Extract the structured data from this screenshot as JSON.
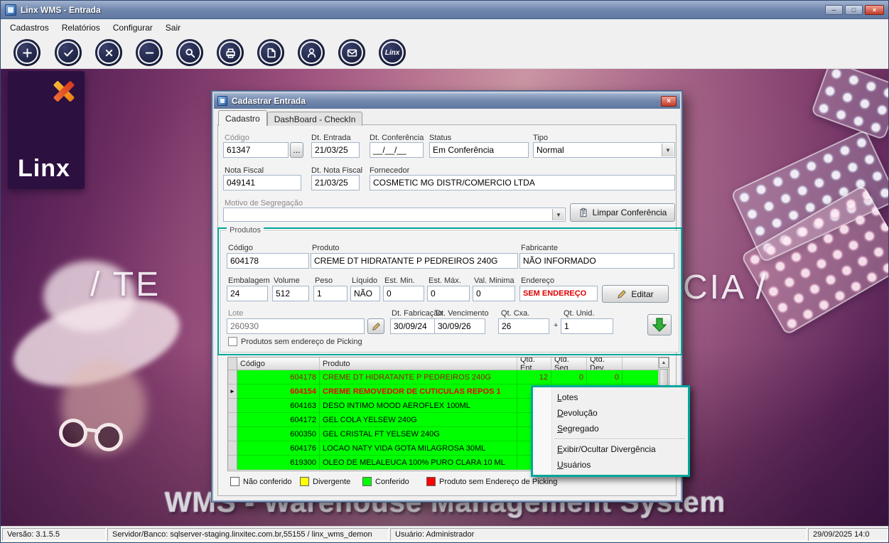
{
  "window": {
    "title": "Linx WMS - Entrada"
  },
  "icons": {
    "minimize": "─",
    "maximize": "□",
    "close": "×",
    "dropdown_arrow": "▼",
    "row_pointer": "►",
    "scroll_up": "▲",
    "scroll_down": "▼"
  },
  "menu": {
    "items": [
      "Cadastros",
      "Relatórios",
      "Configurar",
      "Sair"
    ]
  },
  "toolbar": {
    "linx_label": "Linx",
    "buttons": [
      "add",
      "confirm",
      "cancel",
      "remove",
      "search",
      "print",
      "document",
      "user",
      "send",
      "linx"
    ]
  },
  "background": {
    "logo_text": "Linx",
    "tagline_left": "/ TE",
    "tagline_right": "CIA /",
    "banner": "WMS - Warehouse Management System"
  },
  "dialog": {
    "title": "Cadastrar Entrada",
    "tabs": [
      "Cadastro",
      "DashBoard - CheckIn"
    ],
    "fields": {
      "codigo_label": "Código",
      "codigo": "61347",
      "browse": "...",
      "dt_entrada_label": "Dt. Entrada",
      "dt_entrada": "21/03/25",
      "dt_conferencia_label": "Dt. Conferência",
      "dt_conferencia": "__/__/__",
      "status_label": "Status",
      "status": "Em Conferência",
      "tipo_label": "Tipo",
      "tipo": "Normal",
      "nota_fiscal_label": "Nota Fiscal",
      "nota_fiscal": "049141",
      "dt_nota_fiscal_label": "Dt. Nota Fiscal",
      "dt_nota_fiscal": "21/03/25",
      "fornecedor_label": "Fornecedor",
      "fornecedor": "COSMETIC MG DISTR/COMERCIO LTDA",
      "motivo_label": "Motivo de Segregação",
      "motivo": "",
      "limpar_button": "Limpar Conferência"
    },
    "produtos": {
      "title": "Produtos",
      "codigo_label": "Código",
      "codigo": "604178",
      "produto_label": "Produto",
      "produto": "CREME DT HIDRATANTE P PEDREIROS 240G",
      "fabricante_label": "Fabricante",
      "fabricante": "NÃO INFORMADO",
      "embalagem_label": "Embalagem",
      "embalagem": "24",
      "volume_label": "Volume",
      "volume": "512",
      "peso_label": "Peso",
      "peso": "1",
      "liquido_label": "Líquido",
      "liquido": "NÃO",
      "est_min_label": "Est. Min.",
      "est_min": "0",
      "est_max_label": "Est. Máx.",
      "est_max": "0",
      "val_minima_label": "Val. Minima",
      "val_minima": "0",
      "endereco_label": "Endereço",
      "endereco": "SEM ENDEREÇO",
      "editar_button": "Editar",
      "lote_label": "Lote",
      "lote": "260930",
      "dt_fabricacao_label": "Dt. Fabricação",
      "dt_fabricacao": "30/09/24",
      "dt_vencimento_label": "Dt. Vencimento",
      "dt_vencimento": "30/09/26",
      "qt_cxa_label": "Qt. Cxa.",
      "qt_cxa": "26",
      "plus": "+",
      "qt_unid_label": "Qt. Unid.",
      "qt_unid": "1",
      "picking_checkbox_label": "Produtos sem endereço de Picking"
    },
    "table": {
      "columns": [
        "Código",
        "Produto",
        "Qtd. Ent.",
        "Qtd. Seg.",
        "Qtd. Dev."
      ],
      "rows": [
        {
          "codigo": "604178",
          "produto": "CREME DT HIDRATANTE P PEDREIROS 240G",
          "qtd_ent": "12",
          "qtd_seg": "0",
          "qtd_dev": "0"
        },
        {
          "codigo": "604154",
          "produto": "CREME REMOVEDOR DE CUTICULAS REPOS 1",
          "qtd_ent": "",
          "qtd_seg": "",
          "qtd_dev": "",
          "selected": true
        },
        {
          "codigo": "604163",
          "produto": "DESO INTIMO MOOD AEROFLEX 100ML",
          "qtd_ent": "",
          "qtd_seg": "",
          "qtd_dev": ""
        },
        {
          "codigo": "604172",
          "produto": "GEL COLA YELSEW 240G",
          "qtd_ent": "",
          "qtd_seg": "",
          "qtd_dev": ""
        },
        {
          "codigo": "600350",
          "produto": "GEL CRISTAL FT YELSEW 240G",
          "qtd_ent": "",
          "qtd_seg": "",
          "qtd_dev": ""
        },
        {
          "codigo": "604176",
          "produto": "LOCAO NATY VIDA GOTA MILAGROSA 30ML",
          "qtd_ent": "",
          "qtd_seg": "",
          "qtd_dev": ""
        },
        {
          "codigo": "619300",
          "produto": "OLEO DE MELALEUCA 100% PURO CLARA 10 ML",
          "qtd_ent": "",
          "qtd_seg": "",
          "qtd_dev": ""
        }
      ]
    },
    "legend": [
      {
        "label": "Não conferido",
        "color": "#ffffff"
      },
      {
        "label": "Divergente",
        "color": "#ffff00"
      },
      {
        "label": "Conferido",
        "color": "#00ff00"
      },
      {
        "label": "Produto sem Endereço de Picking",
        "color": "#ff0000"
      }
    ]
  },
  "context_menu": {
    "items": [
      {
        "key": "L",
        "rest": "otes"
      },
      {
        "key": "D",
        "rest": "evolução"
      },
      {
        "key": "S",
        "rest": "egregado"
      },
      {
        "key": "E",
        "rest": "xibir/Ocultar Divergência"
      },
      {
        "key": "U",
        "rest": "suários"
      }
    ]
  },
  "statusbar": {
    "version": "Versão: 3.1.5.5",
    "server": "Servidor/Banco: sqlserver-staging.linxitec.com.br,55155 / linx_wms_demon",
    "user": "Usuário: Administrador",
    "datetime": "29/09/2025 14:0"
  },
  "colors": {
    "highlight_teal": "#00a79b",
    "row_conferido_green": "#00ff00",
    "divergente_yellow": "#ffff00",
    "sem_endereco_red": "#ff0000",
    "endereco_text_red": "#e00000"
  }
}
